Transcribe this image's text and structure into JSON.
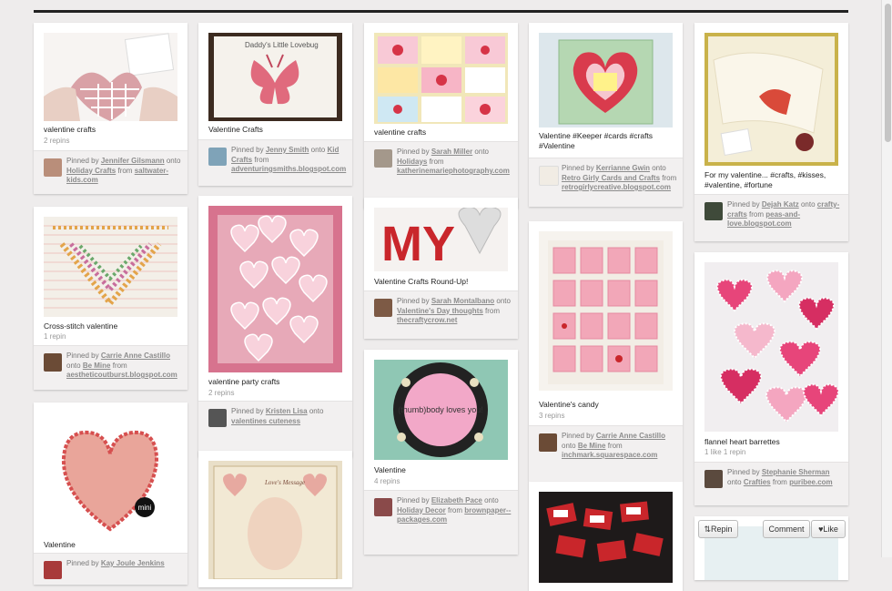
{
  "actions": {
    "repin": "Repin",
    "comment": "Comment",
    "like": "Like"
  },
  "pins": [
    {
      "desc": "valentine crafts",
      "stats": "2 repins",
      "user": "Jennifer Gilsmann",
      "board": "Holiday Crafts",
      "source": "saltwater-kids.com"
    },
    {
      "desc": "Cross-stitch valentine",
      "stats": "1 repin",
      "user": "Carrie Anne Castillo",
      "board": "Be Mine",
      "source": "aestheticoutburst.blogspot.com"
    },
    {
      "desc": "Valentine",
      "stats": "",
      "user": "Kay Joule Jenkins",
      "board": "",
      "source": ""
    },
    {
      "desc": "Valentine Crafts",
      "stats": "",
      "user": "Jenny Smith",
      "board": "Kid Crafts",
      "source": "adventuringsmiths.blogspot.com"
    },
    {
      "desc": "valentine party crafts",
      "stats": "2 repins",
      "user": "Kristen Lisa",
      "board": "valentines cuteness",
      "source": ""
    },
    {
      "desc": "valentine crafts",
      "stats": "",
      "user": "Sarah Miller",
      "board": "Holidays",
      "source": "katherinemariephotography.com"
    },
    {
      "desc": "Valentine Crafts Round-Up!",
      "stats": "",
      "user": "Sarah Montalbano",
      "board": "Valentine's Day thoughts",
      "source": "thecraftycrow.net"
    },
    {
      "desc": "Valentine",
      "stats": "4 repins",
      "user": "Elizabeth Pace",
      "board": "Holiday Decor",
      "source": "brownpaper--packages.com"
    },
    {
      "desc": "Valentine #Keeper #cards #crafts #Valentine",
      "stats": "",
      "user": "Kerrianne Gwin",
      "board": "Retro Girly Cards and Crafts",
      "source": "retrogirlycreative.blogspot.com"
    },
    {
      "desc": "Valentine's candy",
      "stats": "3 repins",
      "user": "Carrie Anne Castillo",
      "board": "Be Mine",
      "source": "inchmark.squarespace.com"
    },
    {
      "desc": "For my valentine... #crafts, #kisses, #valentine, #fortune",
      "stats": "",
      "user": "Dejah Katz",
      "board": "crafty-crafts",
      "source": "peas-and-love.blogspot.com"
    },
    {
      "desc": "flannel heart barrettes",
      "stats": "1 like  1 repin",
      "user": "Stephanie Sherman",
      "board": "Crafties",
      "source": "puribee.com"
    }
  ],
  "attr_words": {
    "pinned_by": "Pinned by",
    "onto": "onto",
    "from": "from"
  },
  "image_text": {
    "daddy": "Daddy's Little Lovebug",
    "my": "MY",
    "thumb": "(thumb)body loves you!",
    "mini": "mini",
    "loves": "Love's Message"
  }
}
